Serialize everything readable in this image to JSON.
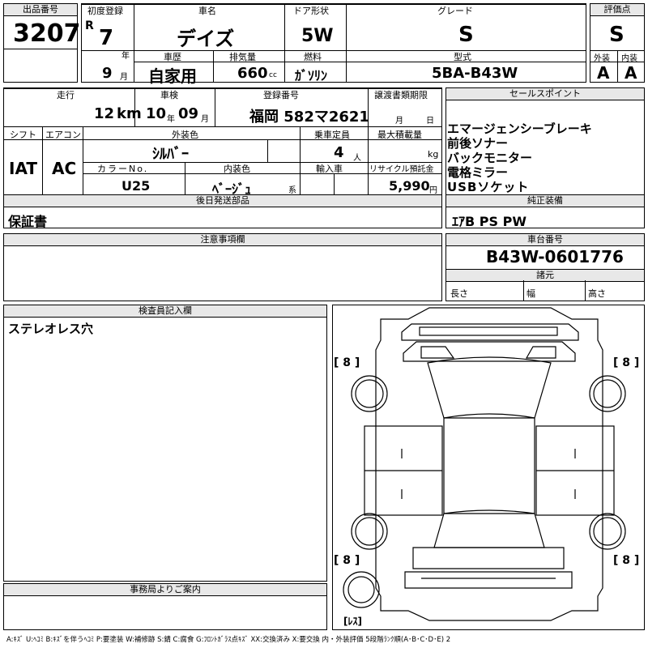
{
  "top": {
    "lot_label": "出品番号",
    "lot_no": "3207",
    "reg_label": "初度登録",
    "era": "R",
    "year": "7",
    "year_unit": "年",
    "month": "9",
    "month_unit": "月",
    "name_label": "車名",
    "name": "デイズ",
    "door_label": "ドア形状",
    "door": "5W",
    "grade_label": "グレード",
    "grade": "S",
    "score_label": "評価点",
    "score": "S",
    "history_label": "車歴",
    "history": "自家用",
    "disp_label": "排気量",
    "disp": "660",
    "disp_unit": "cc",
    "fuel_label": "燃料",
    "fuel": "ｶﾞｿﾘﾝ",
    "model_label": "型式",
    "model": "5BA-B43W",
    "ext_label": "外装",
    "ext": "A",
    "int_label": "内装",
    "int": "A"
  },
  "mid": {
    "mileage_label": "走行",
    "mileage": "12",
    "mileage_unit": "km",
    "inspect_label": "車検",
    "inspect_y": "10",
    "inspect_y_unit": "年",
    "inspect_m": "09",
    "inspect_m_unit": "月",
    "plate_label": "登録番号",
    "plate": "福岡 582マ2621",
    "transfer_label": "譲渡書類期限",
    "transfer_m": "月",
    "transfer_d": "日",
    "shift_label": "シフト",
    "shift": "IAT",
    "ac_label": "エアコン",
    "ac": "AC",
    "color_label": "外装色",
    "color": "ｼﾙﾊﾞｰ",
    "seats_label": "乗車定員",
    "seats": "4",
    "seats_unit": "人",
    "load_label": "最大積載量",
    "load_unit": "kg",
    "colorno_label": "カラーNo.",
    "colorno": "U25",
    "intcolor_label": "内装色",
    "intcolor": "ﾍﾞｰｼﾞｭ",
    "intcolor_unit": "系",
    "import_label": "輸入車",
    "recycle_label": "リサイクル預託金",
    "recycle": "5,990",
    "recycle_unit": "円",
    "later_label": "後日発送部品",
    "later": "保証書"
  },
  "sales": {
    "label": "セールスポイント",
    "lines": [
      "エマージェンシーブレーキ",
      "前後ソナー",
      "バックモニター",
      "電格ミラー",
      "USBソケット"
    ]
  },
  "equip": {
    "label": "純正装備",
    "value": "ｴｱB PS PW"
  },
  "caution": {
    "label": "注意事項欄"
  },
  "chassis": {
    "label": "車台番号",
    "value": "B43W-0601776",
    "spec_label": "諸元",
    "len": "長さ",
    "wid": "幅",
    "hei": "高さ"
  },
  "inspector": {
    "label": "検査員記入欄",
    "text": "ステレオレス穴"
  },
  "office": {
    "label": "事務局よりご案内"
  },
  "diagram": {
    "m1": "[ 8 ]",
    "m2": "[ 8 ]",
    "m3": "[ 8 ]",
    "m4": "[ 8 ]",
    "m5": "[ﾚｽ]"
  },
  "legend": "A:ｷｽﾞ U:ﾍｺﾐ B:ｷｽﾞを伴うﾍｺﾐ P:要塗装 W:補修跡 S:錆 C:腐食 G:ﾌﾛﾝﾄｶﾞﾗｽ点ｷｽﾞ XX:交換済み X:要交換 内・外装評価 5段階ﾗﾝｸ順(A･B･C･D･E) 2"
}
